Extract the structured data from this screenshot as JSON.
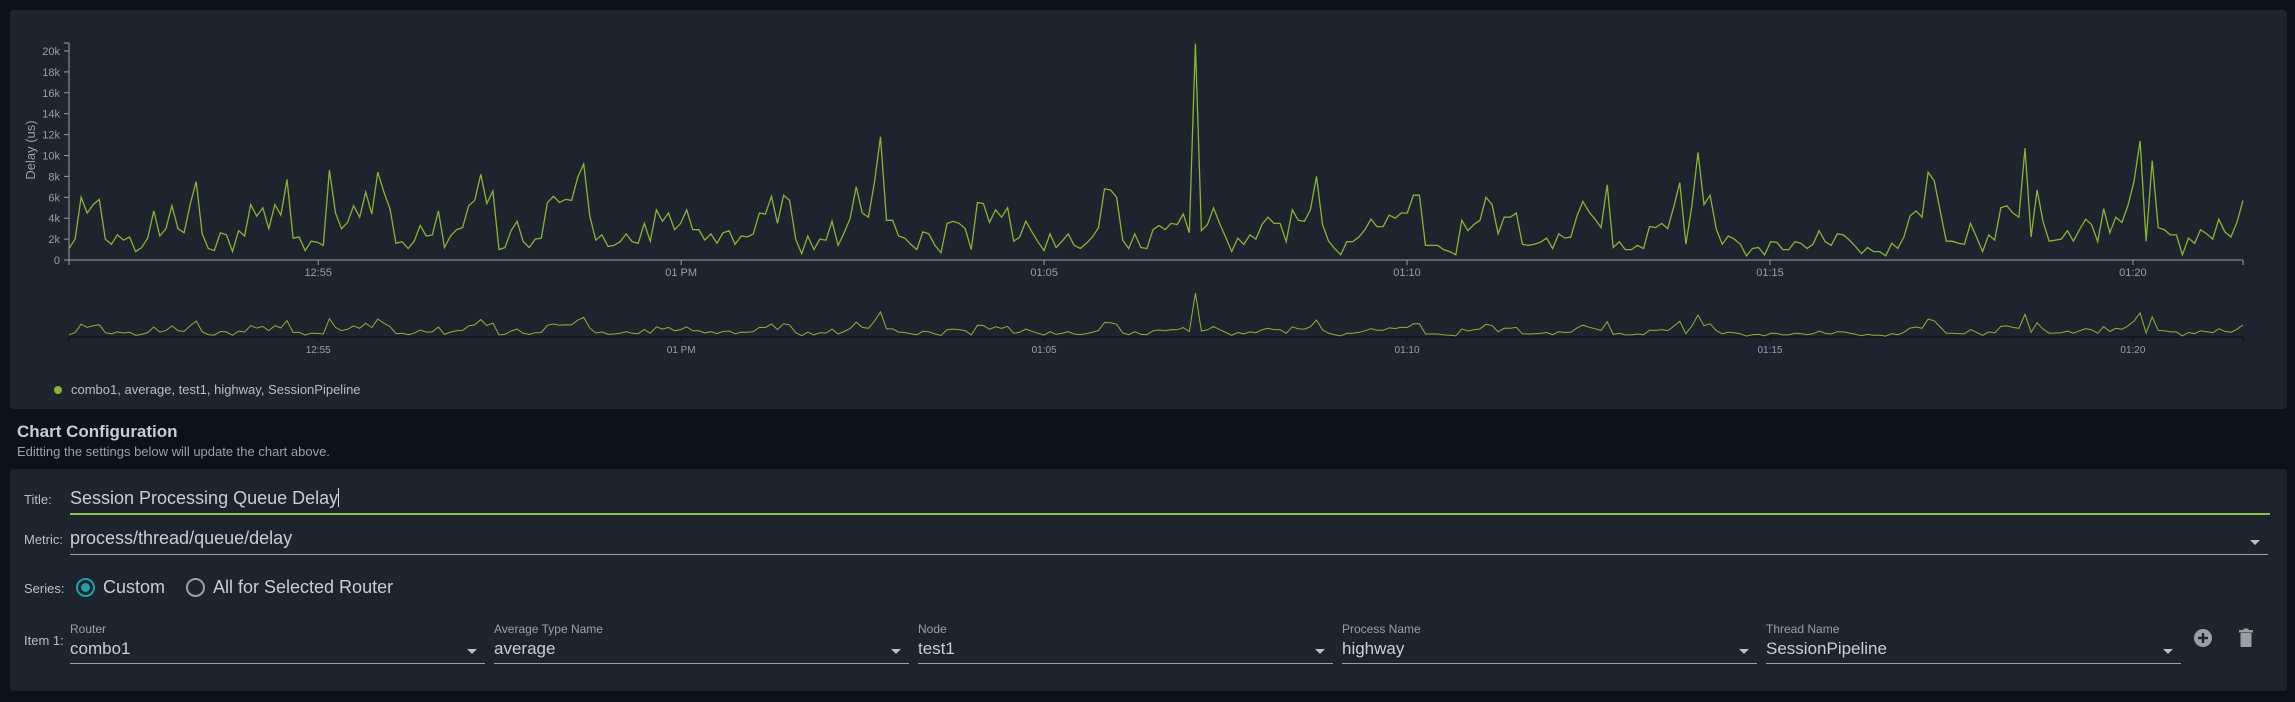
{
  "chart_data": {
    "type": "line",
    "title": "",
    "xlabel": "",
    "ylabel": "Delay (us)",
    "x_start": "12:51:34",
    "x_end": "13:21:31",
    "x_ticks": [
      {
        "time": "12:55",
        "label": "12:55"
      },
      {
        "time": "13:00",
        "label": "01 PM"
      },
      {
        "time": "13:05",
        "label": "01:05"
      },
      {
        "time": "13:10",
        "label": "01:10"
      },
      {
        "time": "13:15",
        "label": "01:15"
      },
      {
        "time": "13:20",
        "label": "01:20"
      }
    ],
    "ylim": [
      0,
      20800
    ],
    "y_ticks": [
      {
        "value": 0,
        "label": "0"
      },
      {
        "value": 2000,
        "label": "2k"
      },
      {
        "value": 4000,
        "label": "4k"
      },
      {
        "value": 6000,
        "label": "6k"
      },
      {
        "value": 8000,
        "label": "8k"
      },
      {
        "value": 10000,
        "label": "10k"
      },
      {
        "value": 12000,
        "label": "12k"
      },
      {
        "value": 14000,
        "label": "14k"
      },
      {
        "value": 16000,
        "label": "16k"
      },
      {
        "value": 18000,
        "label": "18k"
      },
      {
        "value": 20000,
        "label": "20k"
      }
    ],
    "grid": false,
    "legend_position": "bottom-left",
    "series": [
      {
        "name": "combo1, average, test1, highway, SessionPipeline",
        "color": "#86b33a",
        "values": [
          1100,
          2000,
          6000,
          4500,
          5300,
          5800,
          2000,
          1500,
          2400,
          1900,
          2200,
          800,
          1200,
          2100,
          4700,
          2300,
          3000,
          5200,
          3000,
          2600,
          5300,
          7500,
          2500,
          1100,
          900,
          2600,
          2400,
          800,
          2800,
          2300,
          5300,
          4200,
          5000,
          3000,
          5300,
          4300,
          7700,
          2100,
          2200,
          900,
          1800,
          1700,
          1400,
          8600,
          4500,
          3000,
          3600,
          5200,
          4100,
          6500,
          4400,
          8400,
          6500,
          4900,
          1600,
          1750,
          1100,
          1800,
          3300,
          2300,
          2400,
          4700,
          1200,
          2300,
          2900,
          3100,
          5200,
          5700,
          8200,
          5400,
          6600,
          1000,
          1200,
          2800,
          3700,
          1750,
          1200,
          2000,
          2100,
          5500,
          6100,
          5500,
          5800,
          5700,
          7900,
          9200,
          4200,
          1900,
          2400,
          1300,
          1400,
          1750,
          2500,
          1750,
          1600,
          3500,
          1800,
          4800,
          3700,
          4500,
          2900,
          3500,
          4800,
          2900,
          2900,
          1900,
          2500,
          1600,
          2600,
          2800,
          1500,
          2300,
          2200,
          2500,
          4500,
          4400,
          6100,
          3500,
          6200,
          5700,
          2000,
          600,
          2300,
          1000,
          2000,
          1900,
          3700,
          1400,
          2600,
          4000,
          7000,
          4500,
          4100,
          7400,
          11800,
          3800,
          3800,
          2300,
          2100,
          1500,
          1000,
          2700,
          2500,
          1400,
          700,
          3500,
          3700,
          3500,
          3000,
          1000,
          5500,
          5400,
          3600,
          4800,
          4100,
          5000,
          1800,
          2200,
          3700,
          2700,
          1750,
          900,
          2500,
          1200,
          1800,
          2500,
          1400,
          1100,
          1600,
          2200,
          3100,
          6800,
          6700,
          6000,
          1900,
          1100,
          2500,
          1200,
          1100,
          2900,
          3300,
          2900,
          3500,
          3400,
          4400,
          2600,
          20700,
          2800,
          3400,
          5000,
          3500,
          2200,
          800,
          2100,
          1500,
          2400,
          2000,
          3400,
          4100,
          3500,
          3500,
          1750,
          4800,
          3800,
          3700,
          4800,
          8000,
          3400,
          1800,
          1100,
          500,
          1750,
          1750,
          2200,
          2900,
          3900,
          3200,
          3200,
          4300,
          4000,
          4500,
          4500,
          6200,
          6200,
          1400,
          1400,
          1400,
          1000,
          800,
          500,
          3800,
          2800,
          3400,
          3800,
          6000,
          5300,
          2500,
          4100,
          4100,
          4500,
          1500,
          1400,
          1500,
          1700,
          2100,
          1100,
          2500,
          2100,
          2200,
          4200,
          5600,
          4600,
          3900,
          3100,
          7200,
          1200,
          1750,
          1000,
          1000,
          1400,
          1100,
          3200,
          3100,
          3500,
          3000,
          5100,
          7400,
          1500,
          5200,
          10300,
          5300,
          6200,
          3000,
          1500,
          2300,
          2000,
          1500,
          400,
          1100,
          1200,
          500,
          1750,
          1700,
          1000,
          1000,
          1750,
          1600,
          1100,
          1500,
          2800,
          1750,
          1400,
          2500,
          2400,
          1900,
          1300,
          600,
          1200,
          800,
          800,
          400,
          1600,
          1100,
          2200,
          4200,
          4700,
          4100,
          8400,
          7600,
          4700,
          1800,
          1800,
          1600,
          1500,
          3500,
          2200,
          800,
          2400,
          1900,
          5000,
          5200,
          4500,
          4100,
          10700,
          2200,
          6700,
          3600,
          1800,
          1900,
          2000,
          2800,
          1800,
          2900,
          3900,
          3400,
          1750,
          4900,
          2600,
          4100,
          3600,
          5200,
          7500,
          11400,
          1800,
          9500,
          3100,
          2900,
          2400,
          2400,
          500,
          2100,
          1600,
          2900,
          2500,
          2000,
          3900,
          2700,
          2200,
          3600,
          5700
        ]
      }
    ]
  },
  "config": {
    "heading": "Chart Configuration",
    "subheading": "Editting the settings below will update the chart above.",
    "title_label": "Title:",
    "title_value": "Session Processing Queue Delay",
    "metric_label": "Metric:",
    "metric_value": "process/thread/queue/delay",
    "series_label": "Series:",
    "series_options": [
      "Custom",
      "All for Selected Router"
    ],
    "series_selected": "Custom",
    "item_label": "Item 1:",
    "item_fields": [
      {
        "label": "Router",
        "value": "combo1"
      },
      {
        "label": "Average Type Name",
        "value": "average"
      },
      {
        "label": "Node",
        "value": "test1"
      },
      {
        "label": "Process Name",
        "value": "highway"
      },
      {
        "label": "Thread Name",
        "value": "SessionPipeline"
      }
    ],
    "add_icon": "plus-circle-icon",
    "delete_icon": "trash-icon",
    "accent_color": "#8bc34a",
    "radio_color": "#1fa2a8"
  }
}
